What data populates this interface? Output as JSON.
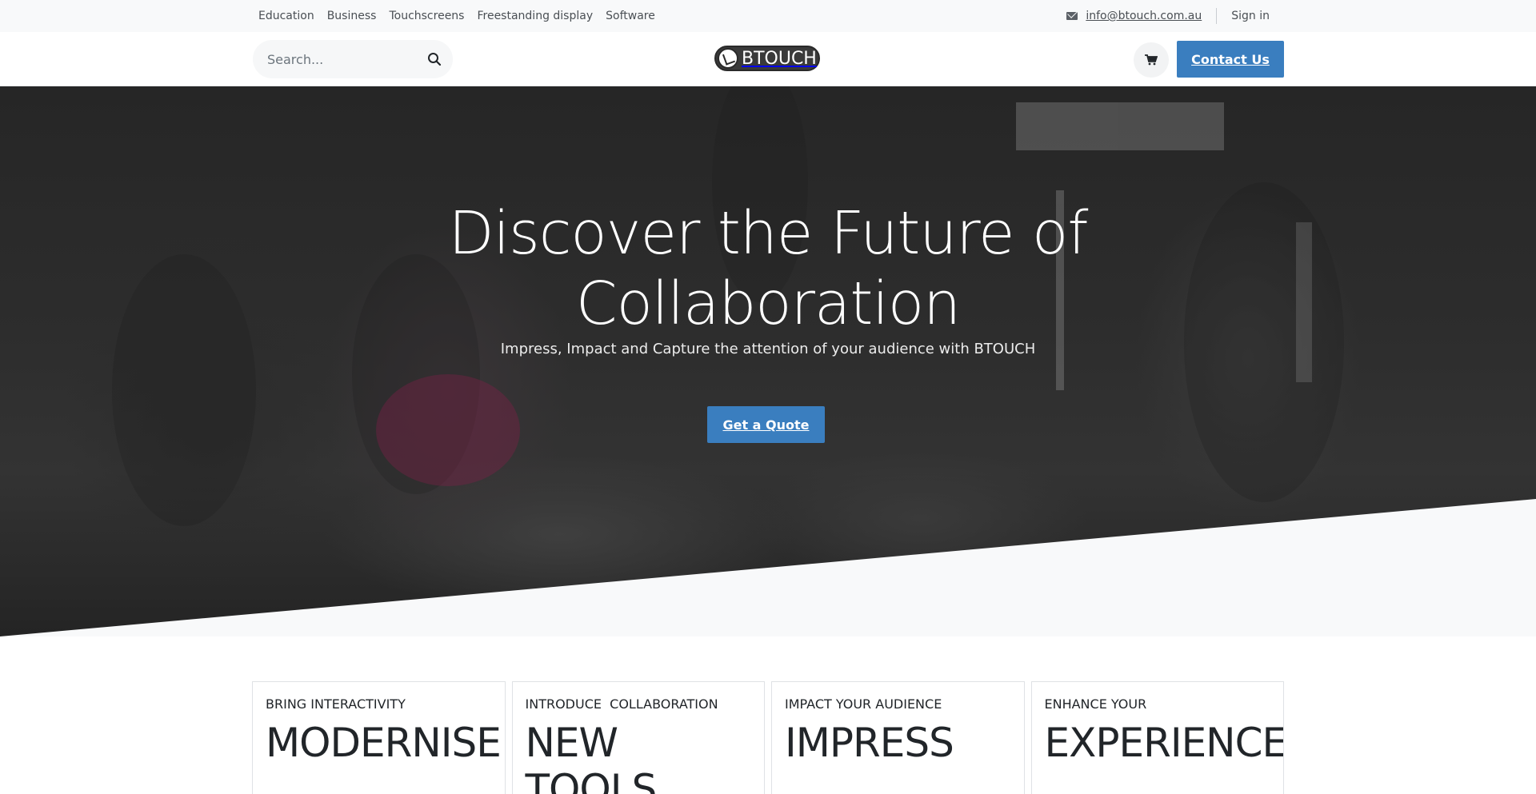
{
  "topbar": {
    "nav": [
      "Education",
      "Business",
      "Touchscreens",
      "Freestanding display",
      "Software"
    ],
    "email": "info@btouch.com.au",
    "signin": "Sign in"
  },
  "header": {
    "search_placeholder": "Search...",
    "logo_text": "BTOUCH",
    "contact_label": "Contact Us"
  },
  "hero": {
    "title_line1": "Discover the Future of",
    "title_line2": "Collaboration",
    "subtitle": "Impress, Impact and Capture the attention of your audience with BTOUCH",
    "cta_label": "Get a Quote"
  },
  "cards": [
    {
      "kicker": "BRING INTERACTIVITY",
      "title": "MODERNISE"
    },
    {
      "kicker": "INTRODUCE  COLLABORATION",
      "title": "NEW TOOLS"
    },
    {
      "kicker": "IMPACT YOUR AUDIENCE",
      "title": "IMPRESS"
    },
    {
      "kicker": "ENHANCE YOUR",
      "title": "EXPERIENCE"
    }
  ],
  "colors": {
    "accent": "#3a7ebf",
    "topbar_bg": "#f8f9fa",
    "hero_bg": "#2b2b2b",
    "section_bg": "#f8f9fa"
  },
  "icons": {
    "mail": "envelope-icon",
    "search": "search-icon",
    "cart": "cart-icon"
  }
}
